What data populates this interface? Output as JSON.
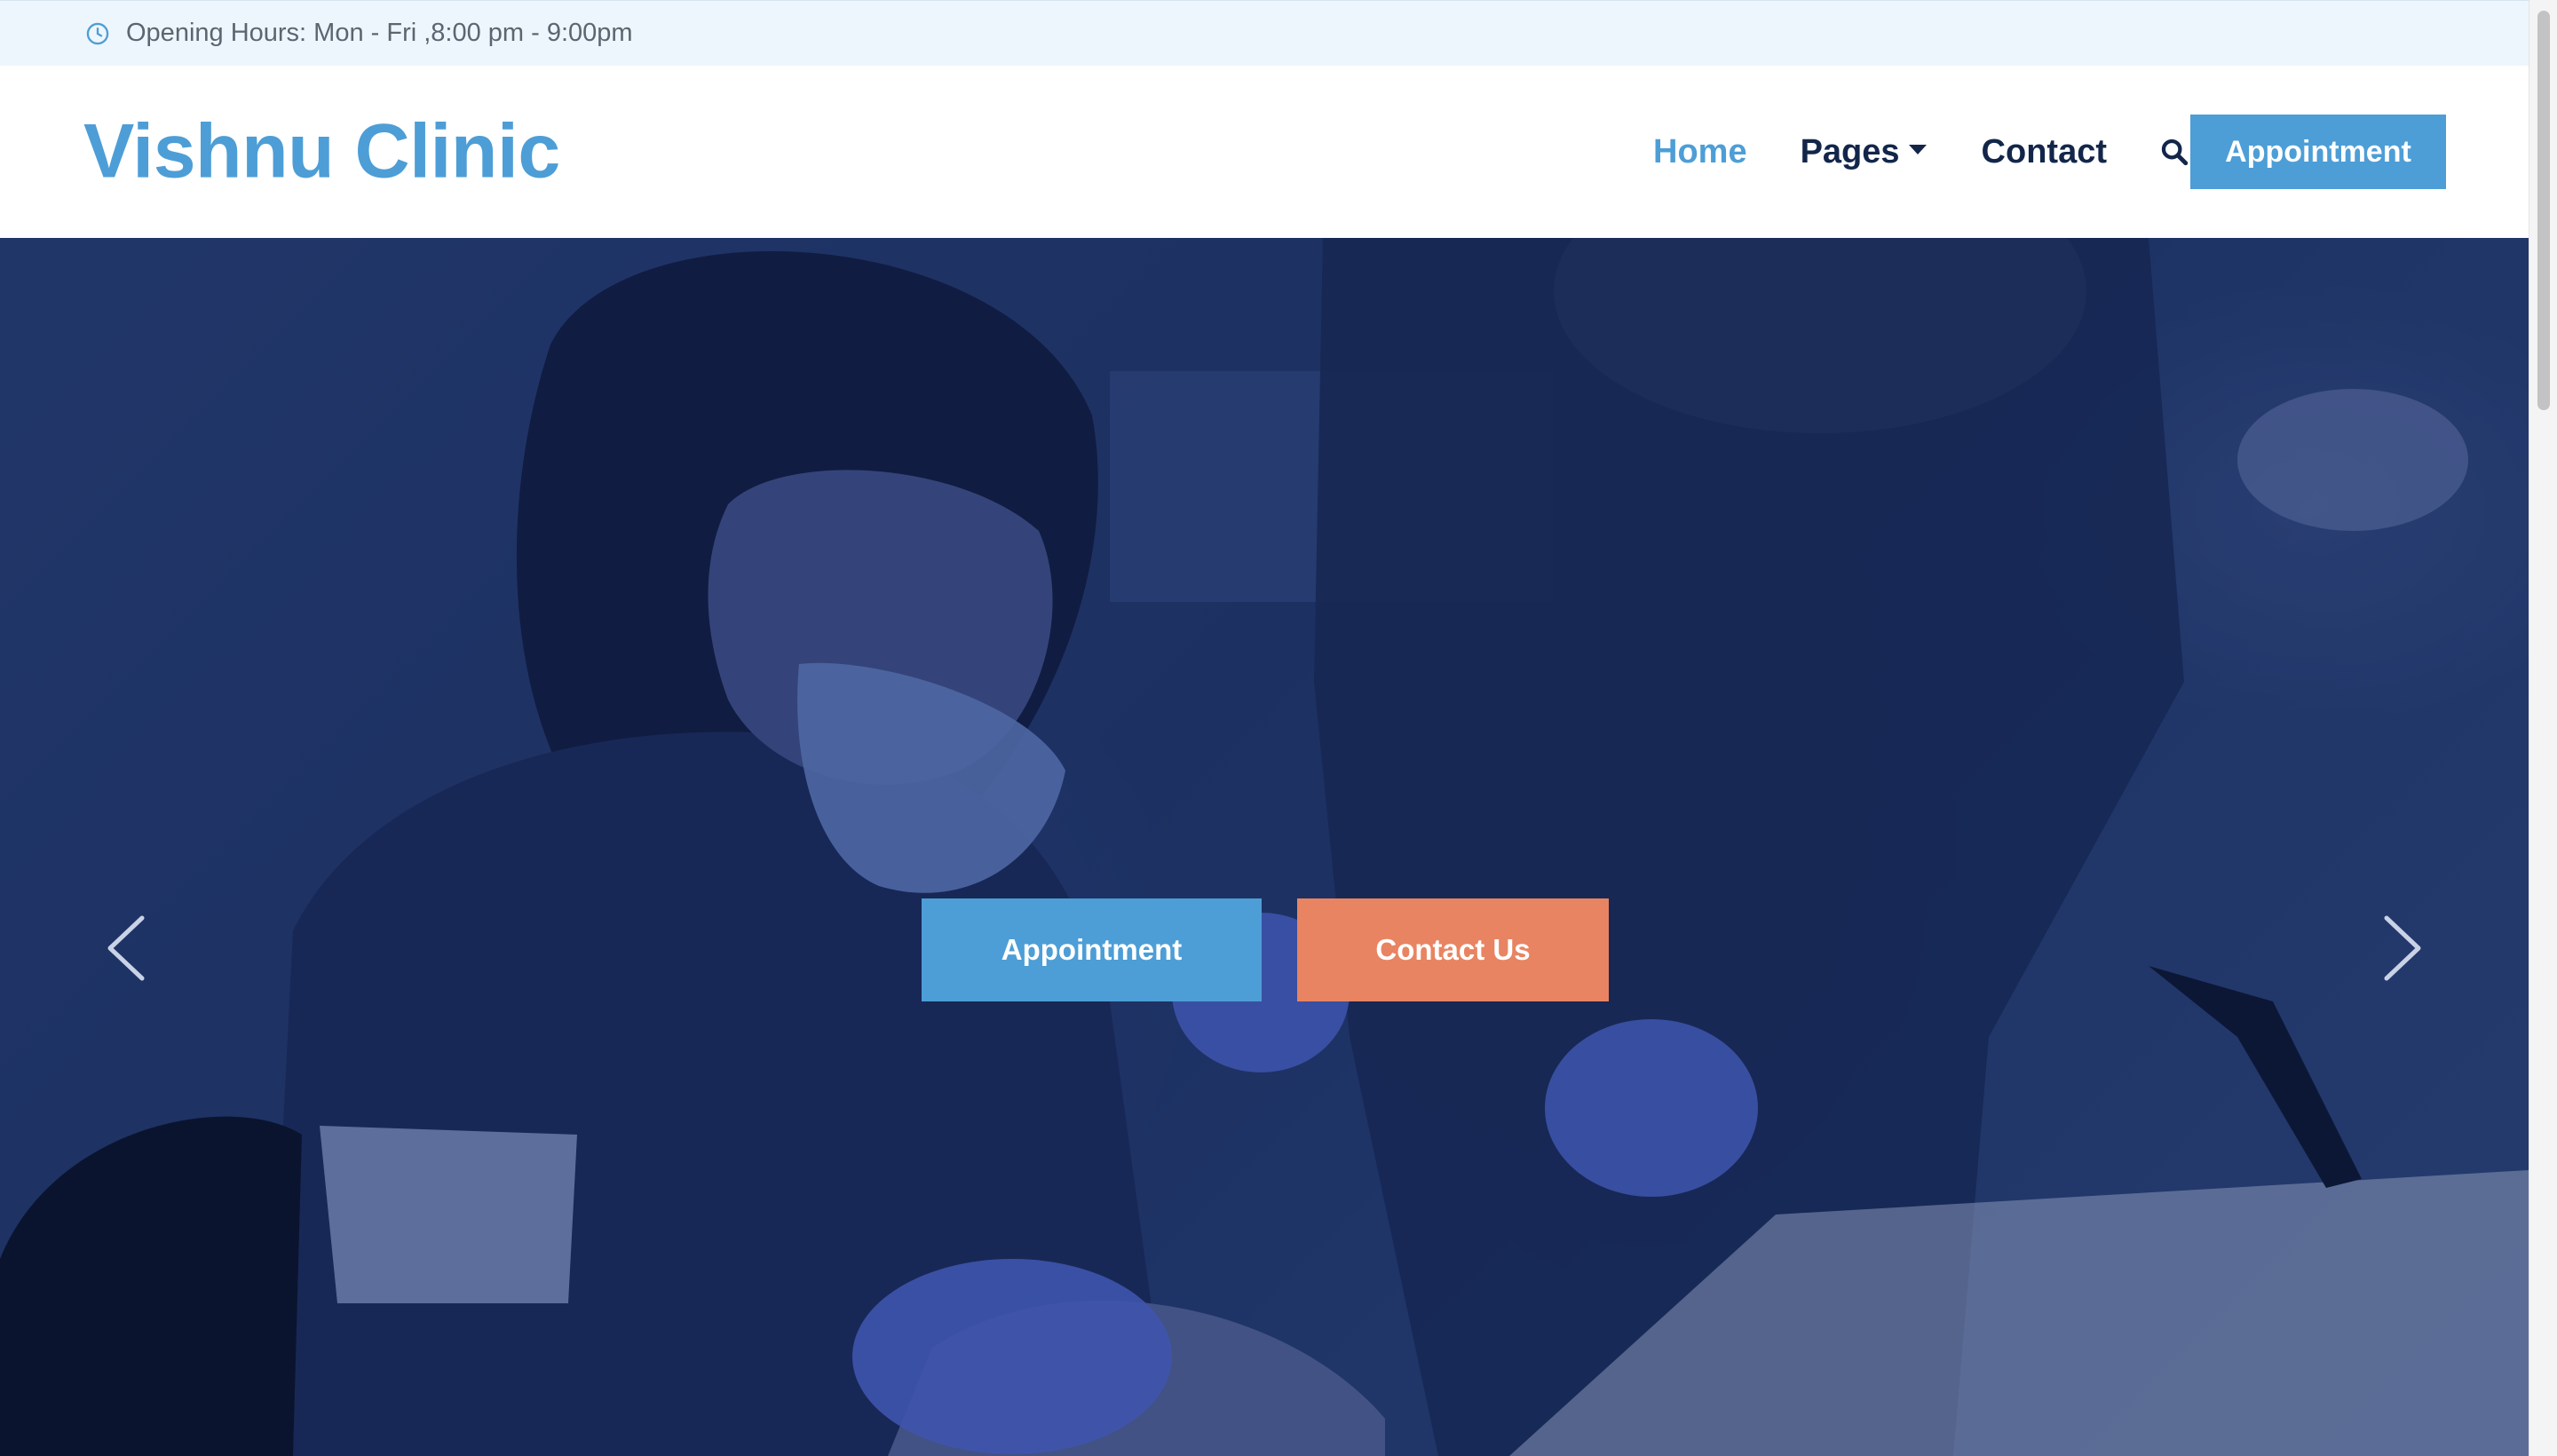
{
  "topbar": {
    "icon": "clock-icon",
    "hours_text": "Opening Hours: Mon - Fri ,8:00 pm - 9:00pm"
  },
  "header": {
    "brand": "Vishnu Clinic",
    "nav": {
      "home": "Home",
      "pages": "Pages",
      "contact": "Contact"
    },
    "search_icon": "search-icon",
    "appointment_button": "Appointment"
  },
  "hero": {
    "appointment_button": "Appointment",
    "contact_button": "Contact Us",
    "prev_icon": "chevron-left-icon",
    "next_icon": "chevron-right-icon"
  },
  "colors": {
    "brand": "#4d9ed6",
    "nav_text": "#13264a",
    "contact_button": "#e88462",
    "topbar_bg": "#eef6fd",
    "hero_overlay": "#1f3366"
  }
}
